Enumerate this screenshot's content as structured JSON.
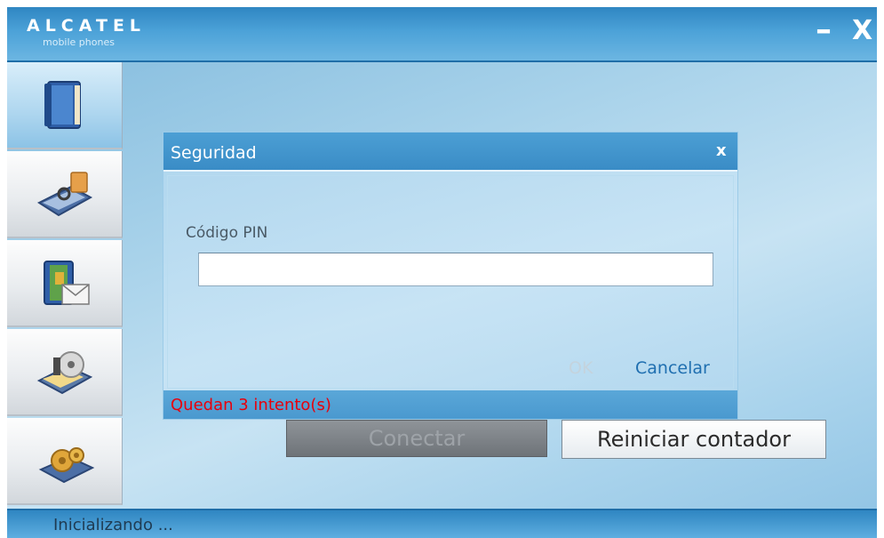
{
  "window": {
    "brand_name": "ALCATEL",
    "brand_sub": "mobile phones",
    "minimize_label": "–",
    "close_label": "X"
  },
  "sidebar": {
    "items": [
      {
        "icon": "phonebook-icon",
        "active": true
      },
      {
        "icon": "connection-icon",
        "active": false
      },
      {
        "icon": "messages-icon",
        "active": false
      },
      {
        "icon": "multimedia-icon",
        "active": false
      },
      {
        "icon": "settings-icon",
        "active": false
      }
    ]
  },
  "dialog": {
    "title": "Seguridad",
    "close_label": "x",
    "pin_label": "Código PIN",
    "pin_value": "",
    "ok_label": "OK",
    "cancel_label": "Cancelar",
    "attempts_text": "Quedan 3 intento(s)"
  },
  "actions": {
    "connect_label": "Conectar",
    "reset_counter_label": "Reiniciar contador"
  },
  "status": {
    "text": "Inicializando ..."
  },
  "colors": {
    "title_bar": "#3a8cc6",
    "attempts_text": "#e8000b",
    "cancel_link": "#1f6fb0"
  }
}
